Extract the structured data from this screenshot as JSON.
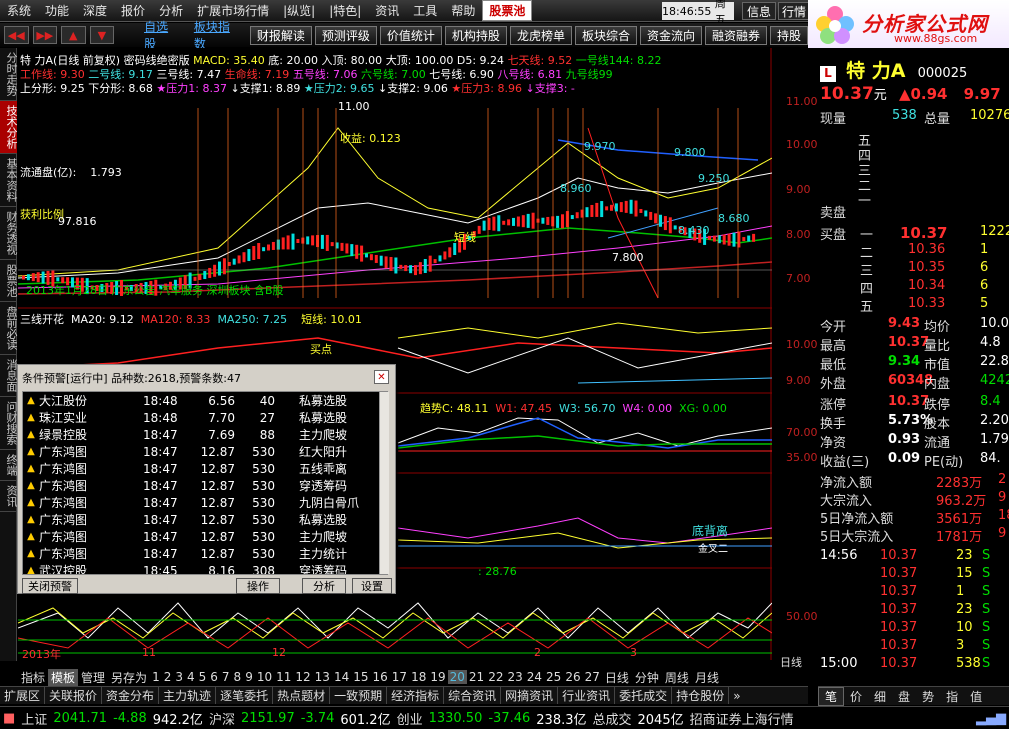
{
  "menu": [
    "系统",
    "功能",
    "深度",
    "报价",
    "分析",
    "扩展市场行情",
    "|纵览|",
    "|特色|",
    "资讯",
    "工具",
    "帮助"
  ],
  "menu_selected": "股票池",
  "clock": {
    "time": "18:46:55",
    "weekday": "周五"
  },
  "top_buttons": [
    "信息",
    "行情"
  ],
  "logo": {
    "title": "分析家公式网",
    "url": "www.88gs.com"
  },
  "toolbar": {
    "links": [
      "自选股",
      "板块指数"
    ],
    "buttons": [
      "财报解读",
      "预测评级",
      "价值统计",
      "机构持股",
      "龙虎榜单",
      "板块综合",
      "资金流向",
      "融资融券",
      "持股"
    ]
  },
  "left_tabs": [
    "分时走势",
    "技术分析",
    "基本资料",
    "财务透视",
    "股票池",
    "盘前必读",
    "消息面",
    "问财搜索",
    "终端",
    "资讯"
  ],
  "chart": {
    "title_line": "特 力A(日线 前复权) 密码线绝密版",
    "macd": "MACD: 35.40",
    "bottom": "底: 20.00",
    "entry": "入顶: 80.00",
    "top": "大顶: 100.00",
    "d5": "D5: 9.24",
    "line7": "七天线: 9.52",
    "line1": "一号线144: 8.22",
    "ma_line2": [
      "工作线: 9.30",
      "二号线: 9.17",
      "三号线: 7.47",
      "生命线: 7.19",
      "五号线: 7.06",
      "六号线: 7.00",
      "七号线: 6.90",
      "八号线: 6.81",
      "九号线99"
    ],
    "ma_line3": [
      "上分形: 9.25",
      "下分形: 8.68",
      "压力1: 8.37",
      "支撑1: 8.89",
      "压力2: 9.65",
      "支撑2: 9.06",
      "压力3: 8.96",
      "支撑3: -"
    ],
    "float_label": "流通盘(亿):",
    "float_value": "1.793",
    "profit_label": "获利比例",
    "profit_value": "97.816",
    "income_label": "收益: 0.123",
    "short_line": "短线",
    "price_labels": [
      "11.00",
      "9.970",
      "9.800",
      "9.250",
      "8.960",
      "8.560",
      "8.430",
      "8.680",
      "7.800"
    ],
    "date_note": "2013年1月28日 广东公告 汽车服务 深圳板块 含B股",
    "sub1": {
      "title": "三线开花",
      "ma20": "MA20: 9.12",
      "ma120": "MA120: 8.33",
      "ma250": "MA250: 7.25",
      "short": "短线: 10.01",
      "buy_label": "买点"
    },
    "sub2": {
      "trend": "趋势C: 48.11",
      "w1": "W1: 47.45",
      "w3": "W3: 56.70",
      "w4": "W4: 0.00",
      "xg": "XG: 0.00"
    },
    "sub3": {
      "divergence": "底背离",
      "golden": "金叉二"
    },
    "sub4": {
      "value": ": 28.76"
    },
    "scale_main": [
      "11.00",
      "10.00",
      "9.00",
      "8.00",
      "7.00"
    ],
    "scale_sub1": [
      "10.00",
      "9.00"
    ],
    "scale_sub2": [
      "70.00",
      "35.00"
    ],
    "scale_sub4": [
      "50.00"
    ],
    "xaxis": {
      "year": "2013年",
      "months": [
        "11",
        "12",
        "2",
        "3"
      ],
      "period": "日线"
    }
  },
  "dialog": {
    "title": "条件预警[运行中] 品种数:2618,预警条数:47",
    "rows": [
      {
        "name": "大江股份",
        "time": "18:48",
        "price": "6.56",
        "num": "40",
        "cond": "私募选股"
      },
      {
        "name": "珠江实业",
        "time": "18:48",
        "price": "7.70",
        "num": "27",
        "cond": "私募选股"
      },
      {
        "name": "绿景控股",
        "time": "18:47",
        "price": "7.69",
        "num": "88",
        "cond": "主力爬坡"
      },
      {
        "name": "广东鸿图",
        "time": "18:47",
        "price": "12.87",
        "num": "530",
        "cond": "红大阳升"
      },
      {
        "name": "广东鸿图",
        "time": "18:47",
        "price": "12.87",
        "num": "530",
        "cond": "五线乖离"
      },
      {
        "name": "广东鸿图",
        "time": "18:47",
        "price": "12.87",
        "num": "530",
        "cond": "穿透筹码"
      },
      {
        "name": "广东鸿图",
        "time": "18:47",
        "price": "12.87",
        "num": "530",
        "cond": "九阴白骨爪"
      },
      {
        "name": "广东鸿图",
        "time": "18:47",
        "price": "12.87",
        "num": "530",
        "cond": "私募选股"
      },
      {
        "name": "广东鸿图",
        "time": "18:47",
        "price": "12.87",
        "num": "530",
        "cond": "主力爬坡"
      },
      {
        "name": "广东鸿图",
        "time": "18:47",
        "price": "12.87",
        "num": "530",
        "cond": "主力统计"
      },
      {
        "name": "武汉控股",
        "time": "18:45",
        "price": "8.16",
        "num": "308",
        "cond": "穿透筹码"
      }
    ],
    "buttons": [
      "关闭预警",
      "操作",
      "分析",
      "设置"
    ]
  },
  "periodbar": {
    "tabs": [
      "指标",
      "模板",
      "管理",
      "另存为"
    ],
    "nums": [
      "1",
      "2",
      "3",
      "4",
      "5",
      "6",
      "7",
      "8",
      "9",
      "10",
      "11",
      "12",
      "13",
      "14",
      "15",
      "16",
      "17",
      "18",
      "19",
      "20",
      "21",
      "22",
      "23",
      "24",
      "25",
      "26",
      "27"
    ],
    "selected_num": "20",
    "periods": [
      "日线",
      "分钟",
      "周线",
      "月线"
    ]
  },
  "funcbar": [
    "扩展区",
    "关联报价",
    "资金分布",
    "主力轨迹",
    "逐笔委托",
    "热点题材",
    "一致预期",
    "经济指标",
    "综合资讯",
    "网摘资讯",
    "行业资讯",
    "委托成交",
    "持仓股份"
  ],
  "status": {
    "sh_label": "上证",
    "sh_val": "2041.71",
    "sh_chg": "-4.88",
    "sh_amt": "942.2亿",
    "hs_label": "沪深",
    "hs_val": "2151.97",
    "hs_chg": "-3.74",
    "hs_amt": "601.2亿",
    "cy_label": "创业",
    "cy_val": "1330.50",
    "cy_chg": "-37.46",
    "cy_amt": "238.3亿",
    "total_label": "总成交",
    "total_val": "2045亿",
    "broker": "招商证券上海行情"
  },
  "quote": {
    "badge": "L",
    "name": "特 力A",
    "code": "000025",
    "price": "10.37",
    "unit": "元",
    "chg": "▲0.94",
    "pct": "9.97",
    "now_label": "现量",
    "now_val": "538",
    "total_label": "总量",
    "total_val": "10276",
    "sell_levels": [
      "五",
      "四",
      "三",
      "二",
      "一"
    ],
    "sell_label": "卖盘",
    "buy_label": "买盘",
    "buys": [
      {
        "lv": "一",
        "price": "10.37",
        "vol": "1222"
      },
      {
        "lv": "二",
        "price": "10.36",
        "vol": "1"
      },
      {
        "lv": "三",
        "price": "10.35",
        "vol": "6"
      },
      {
        "lv": "四",
        "price": "10.34",
        "vol": "6"
      },
      {
        "lv": "五",
        "price": "10.33",
        "vol": "5"
      }
    ],
    "stats": [
      {
        "l1": "今开",
        "v1": "9.43",
        "l2": "均价",
        "v2": "10.0"
      },
      {
        "l1": "最高",
        "v1": "10.37",
        "l2": "量比",
        "v2": "4.8"
      },
      {
        "l1": "最低",
        "v1": "9.34",
        "l2": "市值",
        "v2": "22.8"
      },
      {
        "l1": "外盘",
        "v1": "60348",
        "l2": "内盘",
        "v2": "4242"
      }
    ],
    "stats2": [
      {
        "l1": "涨停",
        "v1": "10.37",
        "l2": "跌停",
        "v2": "8.4"
      },
      {
        "l1": "换手",
        "v1": "5.73%",
        "l2": "股本",
        "v2": "2.20"
      },
      {
        "l1": "净资",
        "v1": "0.93",
        "l2": "流通",
        "v2": "1.79"
      },
      {
        "l1": "收益(三)",
        "v1": "0.09",
        "l2": "PE(动)",
        "v2": "84."
      }
    ],
    "flows": [
      {
        "l": "净流入额",
        "v": "2283万",
        "x": "2"
      },
      {
        "l": "大宗流入",
        "v": "963.2万",
        "x": "9"
      },
      {
        "l": "5日净流入额",
        "v": "3561万",
        "x": "18"
      },
      {
        "l": "5日大宗流入",
        "v": "1781万",
        "x": "9"
      }
    ],
    "ticks": [
      {
        "t": "14:56",
        "p": "10.37",
        "v": "23",
        "s": "S"
      },
      {
        "t": "",
        "p": "10.37",
        "v": "15",
        "s": "S"
      },
      {
        "t": "",
        "p": "10.37",
        "v": "1",
        "s": "S"
      },
      {
        "t": "",
        "p": "10.37",
        "v": "23",
        "s": "S"
      },
      {
        "t": "",
        "p": "10.37",
        "v": "10",
        "s": "S"
      },
      {
        "t": "",
        "p": "10.37",
        "v": "3",
        "s": "S"
      },
      {
        "t": "15:00",
        "p": "10.37",
        "v": "538",
        "s": "S"
      }
    ],
    "tabs": [
      "笔",
      "价",
      "细",
      "盘",
      "势",
      "指",
      "值"
    ]
  },
  "colors": {
    "up": "#ff3030",
    "down": "#00dd00",
    "accent": "#ffff30"
  }
}
